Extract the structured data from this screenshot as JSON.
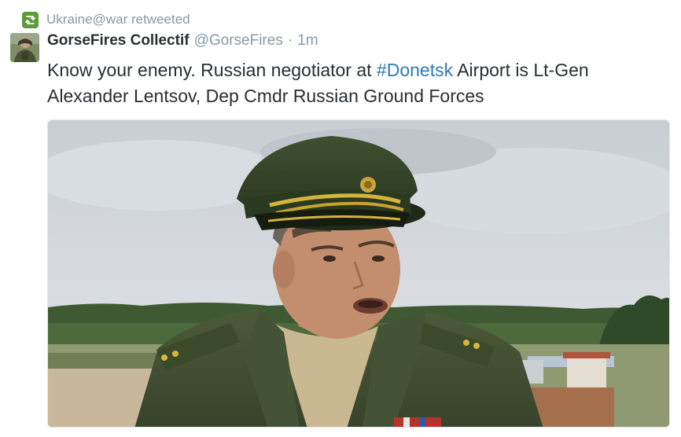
{
  "retweet": {
    "label": "Ukraine@war retweeted",
    "icon": "retweet-icon",
    "icon_color": "#5c9a3a"
  },
  "tweet": {
    "author_name": "GorseFires Collectif",
    "username": "@GorseFires",
    "separator": "·",
    "time": "1m",
    "text_before": "Know your enemy. Russian negotiator at ",
    "hashtag": "#Donetsk",
    "text_after": " Airport is Lt-Gen Alexander Lentsov, Dep Cmdr Russian Ground Forces",
    "hashtag_color": "#2b7bb9"
  },
  "media": {
    "icon": "photo"
  }
}
